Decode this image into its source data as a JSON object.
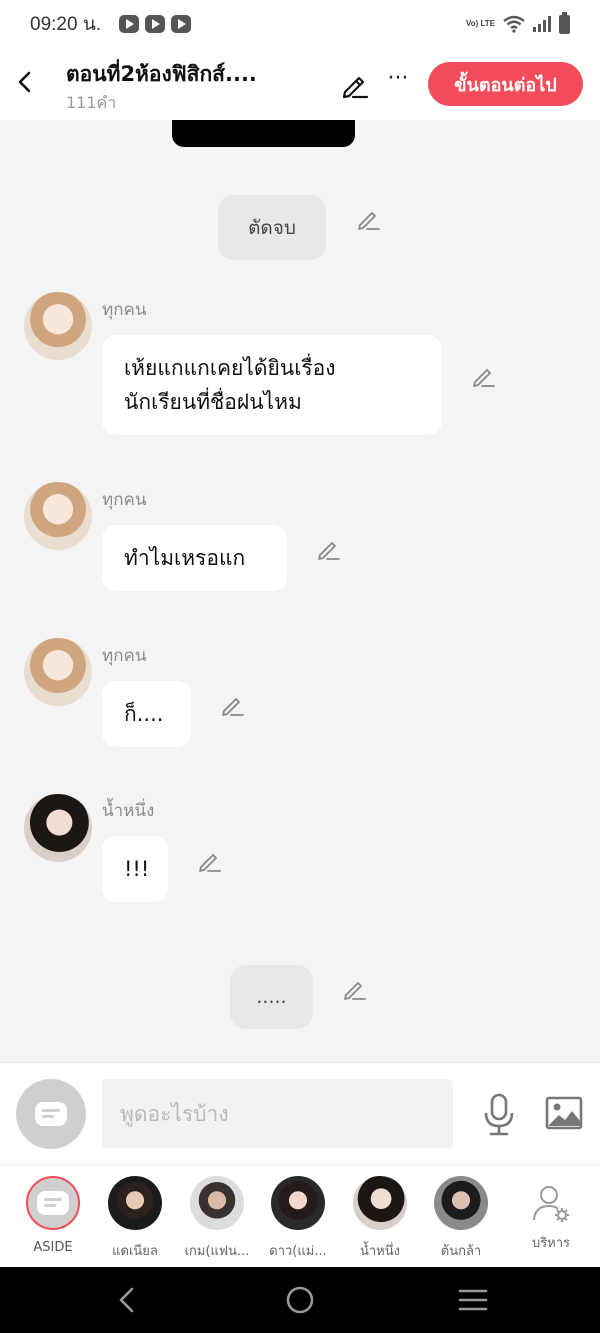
{
  "status_bar": {
    "time": "09:20 น.",
    "network_label": "Vo) LTE",
    "icons": [
      "youtube-icon",
      "youtube-icon",
      "youtube-icon",
      "wifi-icon",
      "signal-icon",
      "battery-icon"
    ]
  },
  "header": {
    "title": "ตอนที่2ห้องฟิสิกส์....",
    "word_count": "111คำ",
    "next_button": "ขั้นตอนต่อไป",
    "more_label": "···",
    "accent_color": "#f24c5a"
  },
  "chat": {
    "messages": [
      {
        "type": "narration",
        "text": "ตัดจบ"
      },
      {
        "type": "character",
        "speaker": "ทุกคน",
        "text": "เห้ยแกแกเคยได้ยินเรื่อง\nนักเรียนที่ชื่อฝนไหม"
      },
      {
        "type": "character",
        "speaker": "ทุกคน",
        "text": "ทำไมเหรอแก"
      },
      {
        "type": "character",
        "speaker": "ทุกคน",
        "text": "ก็...."
      },
      {
        "type": "character",
        "speaker": "น้ำหนึ่ง",
        "text": "!!!"
      },
      {
        "type": "narration",
        "text": "....."
      }
    ]
  },
  "composer": {
    "placeholder": "พูดอะไรบ้าง",
    "value": ""
  },
  "characters": [
    {
      "name": "ASIDE"
    },
    {
      "name": "แดเนียล"
    },
    {
      "name": "เกม(แฟน..."
    },
    {
      "name": "ดาว(แม่..."
    },
    {
      "name": "น้ำหนึ่ง"
    },
    {
      "name": "ต้นกล้า"
    },
    {
      "name": "บริหาร"
    }
  ]
}
